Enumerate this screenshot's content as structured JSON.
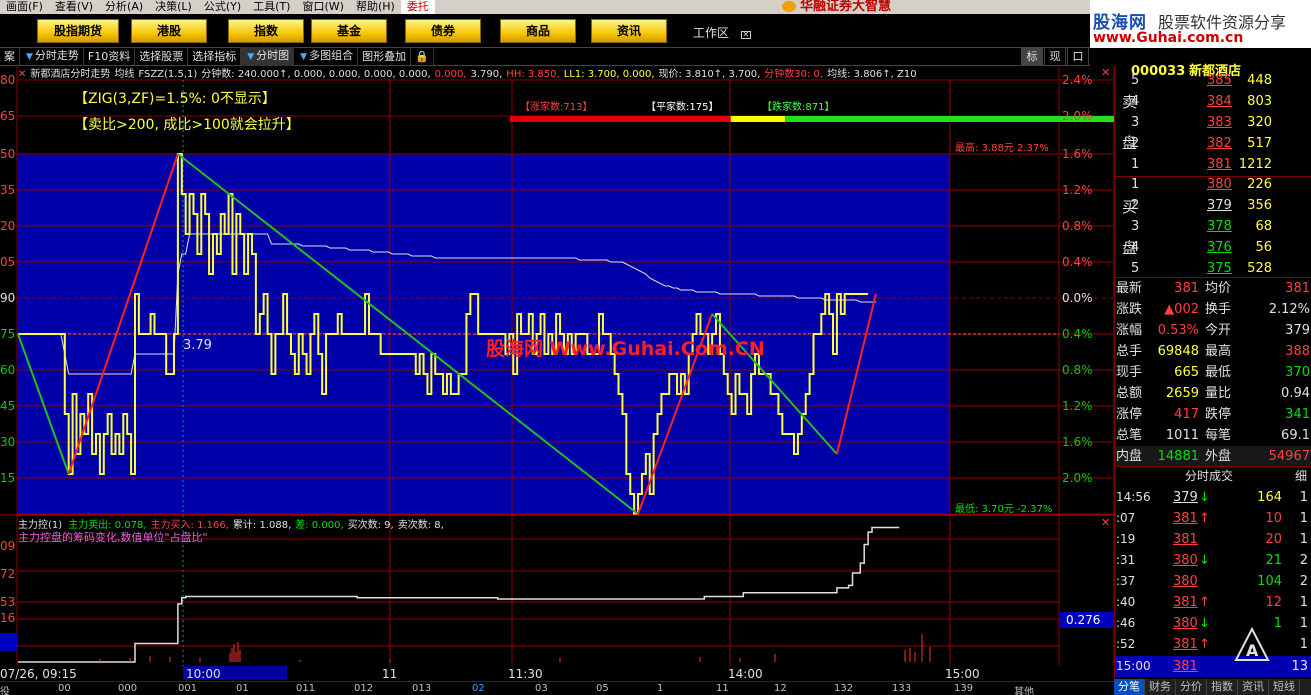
{
  "menubar": {
    "items": [
      "画面(F)",
      "查看(V)",
      "分析(A)",
      "决策(L)",
      "公式(Y)",
      "工具(T)",
      "窗口(W)",
      "帮助(H)",
      "委托"
    ],
    "brand": "华融证券大智慧"
  },
  "logo": {
    "site": "股海网",
    "tagline": "股票软件资源分享",
    "url": "www.Guhai.com.cn"
  },
  "tabs": [
    "股指期货",
    "港股",
    "指数",
    "基金",
    "债券",
    "商品",
    "资讯"
  ],
  "workarea": {
    "label": "工作区",
    "icon": "close-icon"
  },
  "toolbar": {
    "items": [
      "案",
      "分时走势",
      "F10资料",
      "选择股票",
      "选择指标",
      "分时图",
      "多图组合",
      "图形叠加"
    ],
    "right": [
      "标",
      "现",
      "口"
    ]
  },
  "chart": {
    "title": "新都酒店分时走势",
    "info": [
      {
        "t": "均线",
        "c": "wht"
      },
      {
        "t": "FSZZ(1.5,1)",
        "c": "wht"
      },
      {
        "t": "分钟数: 240.000↑, 0.000, 0.000, 0.000, 0.000,",
        "c": "wht"
      },
      {
        "t": "0.000,",
        "c": "red"
      },
      {
        "t": "3.790,",
        "c": "wht"
      },
      {
        "t": "HH: 3.850,",
        "c": "red"
      },
      {
        "t": "LL1: 3.700, 0.000,",
        "c": "yel"
      },
      {
        "t": "现价: 3.810↑, 3.700,",
        "c": "wht"
      },
      {
        "t": "分钟数30: 0,",
        "c": "red"
      },
      {
        "t": "均线: 3.806↑, Z10",
        "c": "wht"
      }
    ],
    "notes": [
      "【ZIG(3,ZF)=1.5%:  0不显示】",
      "【卖比>200,  成比>100就会拉升】"
    ],
    "breadth": {
      "up": "【涨家数:713】",
      "flat": "【平家数:175】",
      "down": "【跌家数:871】",
      "up_count": 713,
      "flat_count": 175,
      "down_count": 871
    },
    "marker_price": "3.79",
    "high_label": "最高: 3.88元  2.37%",
    "low_label": "最低: 3.70元  -2.37%",
    "watermark": "股海网 Www.Guhai.Com.CN",
    "left_axis": [
      "80",
      "65",
      "50",
      "35",
      "20",
      "05",
      "90",
      "75",
      "60",
      "45",
      "30",
      "15"
    ],
    "right_axis": [
      "2.4%",
      "2.0%",
      "1.6%",
      "1.2%",
      "0.8%",
      "0.4%",
      "0.0%",
      "0.4%",
      "0.8%",
      "1.2%",
      "1.6%",
      "2.0%"
    ],
    "price_min": 3.7,
    "price_max": 3.88,
    "prev_close": 3.79,
    "price_series": [
      3.79,
      3.79,
      3.79,
      3.79,
      3.79,
      3.79,
      3.79,
      3.79,
      3.79,
      3.79,
      3.79,
      3.79,
      3.75,
      3.72,
      3.76,
      3.73,
      3.75,
      3.74,
      3.76,
      3.73,
      3.74,
      3.72,
      3.74,
      3.75,
      3.73,
      3.74,
      3.73,
      3.75,
      3.74,
      3.72,
      3.81,
      3.79,
      3.79,
      3.79,
      3.8,
      3.79,
      3.79,
      3.79,
      3.77,
      3.77,
      3.79,
      3.88,
      3.86,
      3.84,
      3.86,
      3.85,
      3.83,
      3.86,
      3.85,
      3.82,
      3.84,
      3.83,
      3.85,
      3.84,
      3.86,
      3.82,
      3.85,
      3.84,
      3.82,
      3.84,
      3.83,
      3.79,
      3.8,
      3.81,
      3.79,
      3.77,
      3.79,
      3.79,
      3.81,
      3.79,
      3.78,
      3.77,
      3.79,
      3.78,
      3.77,
      3.79,
      3.8,
      3.78,
      3.76,
      3.79,
      3.79,
      3.79,
      3.8,
      3.79,
      3.79,
      3.79,
      3.79,
      3.79,
      3.79,
      3.81,
      3.79,
      3.79,
      3.79,
      3.78,
      3.78,
      3.78,
      3.78,
      3.78,
      3.78,
      3.78,
      3.78,
      3.78,
      3.77,
      3.78,
      3.77,
      3.76,
      3.78,
      3.77,
      3.77,
      3.76,
      3.77,
      3.76,
      3.76,
      3.77,
      3.77,
      3.8,
      3.81,
      3.81,
      3.79,
      3.79,
      3.79,
      3.79,
      3.79,
      3.79,
      3.79,
      3.78,
      3.79,
      3.77,
      3.8,
      3.79,
      3.79,
      3.8,
      3.78,
      3.79,
      3.8,
      3.78,
      3.79,
      3.78,
      3.8,
      3.79,
      3.78,
      3.79,
      3.78,
      3.79,
      3.79,
      3.79,
      3.78,
      3.78,
      3.78,
      3.8,
      3.79,
      3.79,
      3.78,
      3.77,
      3.76,
      3.75,
      3.72,
      3.71,
      3.7,
      3.71,
      3.72,
      3.73,
      3.71,
      3.74,
      3.75,
      3.76,
      3.76,
      3.77,
      3.77,
      3.76,
      3.77,
      3.76,
      3.78,
      3.79,
      3.8,
      3.79,
      3.79,
      3.78,
      3.79,
      3.8,
      3.78,
      3.77,
      3.76,
      3.75,
      3.77,
      3.76,
      3.76,
      3.75,
      3.77,
      3.78,
      3.77,
      3.77,
      3.77,
      3.76,
      3.76,
      3.75,
      3.74,
      3.74,
      3.74,
      3.73,
      3.74,
      3.75,
      3.76,
      3.77,
      3.79,
      3.79,
      3.8,
      3.81,
      3.8,
      3.78,
      3.81,
      3.8,
      3.81,
      3.81,
      3.81,
      3.81,
      3.81,
      3.81,
      3.81
    ],
    "avg_series": [
      3.79,
      3.79,
      3.79,
      3.79,
      3.79,
      3.79,
      3.79,
      3.79,
      3.79,
      3.79,
      3.79,
      3.79,
      3.78,
      3.77,
      3.77,
      3.77,
      3.77,
      3.77,
      3.77,
      3.77,
      3.77,
      3.77,
      3.77,
      3.77,
      3.77,
      3.77,
      3.77,
      3.77,
      3.77,
      3.77,
      3.78,
      3.78,
      3.78,
      3.78,
      3.78,
      3.78,
      3.78,
      3.78,
      3.78,
      3.78,
      3.78,
      3.82,
      3.83,
      3.83,
      3.84,
      3.84,
      3.84,
      3.84,
      3.84,
      3.84,
      3.84,
      3.84,
      3.84,
      3.84,
      3.84,
      3.84,
      3.84,
      3.84,
      3.84,
      3.84,
      3.84,
      3.84,
      3.84,
      3.84,
      3.84,
      3.835,
      3.835,
      3.835,
      3.835,
      3.835,
      3.835,
      3.835,
      3.835,
      3.834,
      3.834,
      3.834,
      3.834,
      3.834,
      3.834,
      3.834,
      3.833,
      3.833,
      3.833,
      3.833,
      3.833,
      3.832,
      3.832,
      3.832,
      3.832,
      3.832,
      3.832,
      3.831,
      3.831,
      3.831,
      3.831,
      3.831,
      3.83,
      3.83,
      3.83,
      3.83,
      3.83,
      3.829,
      3.829,
      3.829,
      3.829,
      3.829,
      3.829,
      3.828,
      3.828,
      3.828,
      3.828,
      3.828,
      3.828,
      3.828,
      3.828,
      3.828,
      3.828,
      3.828,
      3.828,
      3.828,
      3.828,
      3.828,
      3.828,
      3.828,
      3.828,
      3.828,
      3.828,
      3.828,
      3.828,
      3.828,
      3.828,
      3.828,
      3.828,
      3.828,
      3.828,
      3.828,
      3.828,
      3.828,
      3.828,
      3.828,
      3.828,
      3.828,
      3.828,
      3.828,
      3.827,
      3.827,
      3.827,
      3.827,
      3.827,
      3.827,
      3.827,
      3.827,
      3.826,
      3.826,
      3.826,
      3.826,
      3.825,
      3.824,
      3.823,
      3.822,
      3.821,
      3.82,
      3.818,
      3.817,
      3.816,
      3.815,
      3.814,
      3.814,
      3.813,
      3.813,
      3.812,
      3.812,
      3.812,
      3.812,
      3.811,
      3.811,
      3.811,
      3.811,
      3.811,
      3.811,
      3.81,
      3.81,
      3.81,
      3.81,
      3.81,
      3.81,
      3.81,
      3.81,
      3.81,
      3.81,
      3.809,
      3.809,
      3.809,
      3.809,
      3.809,
      3.809,
      3.809,
      3.809,
      3.809,
      3.809,
      3.808,
      3.808,
      3.808,
      3.808,
      3.808,
      3.808,
      3.808,
      3.807,
      3.807,
      3.807,
      3.807,
      3.807,
      3.807,
      3.807,
      3.807,
      3.807,
      3.806,
      3.806,
      3.806,
      3.806,
      3.806
    ],
    "zig_points": [
      {
        "i": 0,
        "p": 3.79
      },
      {
        "i": 13,
        "p": 3.72
      },
      {
        "i": 41,
        "p": 3.88
      },
      {
        "i": 159,
        "p": 3.7
      },
      {
        "i": 178,
        "p": 3.8
      },
      {
        "i": 210,
        "p": 3.73
      },
      {
        "i": 220,
        "p": 3.81
      }
    ],
    "time_labels": [
      "10:00",
      "11",
      "11:30",
      "14:00",
      "15:00"
    ]
  },
  "sub_chart": {
    "title": "主力控(1)",
    "info": [
      {
        "t": "主力卖出: 0.078,",
        "c": "grn"
      },
      {
        "t": "主力买入: 1.166,",
        "c": "red"
      },
      {
        "t": "累计: 1.088,",
        "c": "wht"
      },
      {
        "t": "差: 0.000,",
        "c": "grn"
      },
      {
        "t": "买次数: 9,",
        "c": "wht"
      },
      {
        "t": "卖次数: 8,",
        "c": "wht"
      }
    ],
    "desc": "主力控盘的筹码变化,数值单位\"占盘比\"",
    "left_axis": [
      "09",
      "72",
      "53",
      "16"
    ],
    "right_value": "0.276",
    "cum_series": [
      0,
      0,
      0,
      0,
      0,
      0,
      0,
      0,
      0,
      0,
      0,
      0,
      0,
      0,
      0,
      0,
      0,
      0,
      0,
      0,
      0,
      0,
      0,
      0,
      0,
      0,
      0,
      0,
      0,
      0,
      0.15,
      0.15,
      0.15,
      0.15,
      0.15,
      0.15,
      0.15,
      0.15,
      0.15,
      0.15,
      0.15,
      0.47,
      0.52,
      0.53,
      0.53,
      0.53,
      0.53,
      0.53,
      0.53,
      0.53,
      0.53,
      0.53,
      0.53,
      0.53,
      0.53,
      0.53,
      0.53,
      0.53,
      0.53,
      0.53,
      0.53,
      0.53,
      0.53,
      0.53,
      0.53,
      0.53,
      0.53,
      0.53,
      0.53,
      0.53,
      0.53,
      0.53,
      0.53,
      0.53,
      0.53,
      0.53,
      0.53,
      0.53,
      0.53,
      0.53,
      0.53,
      0.53,
      0.53,
      0.53,
      0.53,
      0.53,
      0.53,
      0.52,
      0.52,
      0.52,
      0.52,
      0.52,
      0.52,
      0.52,
      0.52,
      0.52,
      0.52,
      0.52,
      0.52,
      0.52,
      0.52,
      0.52,
      0.52,
      0.52,
      0.52,
      0.52,
      0.52,
      0.52,
      0.52,
      0.52,
      0.52,
      0.52,
      0.52,
      0.52,
      0.52,
      0.52,
      0.52,
      0.52,
      0.52,
      0.52,
      0.52,
      0.52,
      0.52,
      0.51,
      0.51,
      0.51,
      0.51,
      0.51,
      0.51,
      0.51,
      0.51,
      0.51,
      0.51,
      0.51,
      0.51,
      0.51,
      0.51,
      0.51,
      0.51,
      0.51,
      0.51,
      0.51,
      0.51,
      0.51,
      0.51,
      0.51,
      0.51,
      0.51,
      0.51,
      0.51,
      0.51,
      0.51,
      0.51,
      0.51,
      0.51,
      0.51,
      0.51,
      0.51,
      0.51,
      0.51,
      0.51,
      0.51,
      0.51,
      0.51,
      0.51,
      0.51,
      0.51,
      0.51,
      0.51,
      0.51,
      0.51,
      0.51,
      0.51,
      0.51,
      0.51,
      0.51,
      0.53,
      0.53,
      0.53,
      0.53,
      0.53,
      0.53,
      0.53,
      0.53,
      0.53,
      0.53,
      0.56,
      0.56,
      0.56,
      0.56,
      0.56,
      0.56,
      0.56,
      0.56,
      0.56,
      0.56,
      0.56,
      0.56,
      0.56,
      0.56,
      0.56,
      0.56,
      0.56,
      0.56,
      0.56,
      0.56,
      0.56,
      0.56,
      0.56,
      0.56,
      0.6,
      0.6,
      0.6,
      0.62,
      0.72,
      0.72,
      0.8,
      0.95,
      1.05,
      1.088,
      1.088,
      1.088,
      1.088,
      1.088,
      1.088,
      1.088,
      1.088
    ],
    "cum_max": 1.1
  },
  "bottom_bar": {
    "date_label": "07/26, 09:15",
    "codes": [
      "役",
      "00",
      "000",
      "001",
      "01",
      "011",
      "012",
      "013",
      "02",
      "03",
      "05",
      "1",
      "11",
      "12",
      "132",
      "133",
      "139",
      "其他"
    ]
  },
  "quote": {
    "code": "000033",
    "name": "新都酒店",
    "sell_side": "卖盘",
    "buy_side": "买盘",
    "sell": [
      {
        "n": "5",
        "price": "385",
        "vol": "448"
      },
      {
        "n": "4",
        "price": "384",
        "vol": "803"
      },
      {
        "n": "3",
        "price": "383",
        "vol": "320"
      },
      {
        "n": "2",
        "price": "382",
        "vol": "517"
      },
      {
        "n": "1",
        "price": "381",
        "vol": "1212"
      }
    ],
    "buy": [
      {
        "n": "1",
        "price": "380",
        "vol": "226"
      },
      {
        "n": "2",
        "price": "379",
        "vol": "356"
      },
      {
        "n": "3",
        "price": "378",
        "vol": "68"
      },
      {
        "n": "4",
        "price": "376",
        "vol": "56"
      },
      {
        "n": "5",
        "price": "375",
        "vol": "528"
      }
    ],
    "stats": [
      {
        "l1": "最新",
        "v1": "381",
        "c1": "red",
        "l2": "均价",
        "v2": "381",
        "c2": "red"
      },
      {
        "l1": "涨跌",
        "v1": "▲002",
        "c1": "red",
        "l2": "换手",
        "v2": "2.12%",
        "c2": "wht"
      },
      {
        "l1": "涨幅",
        "v1": "0.53%",
        "c1": "red",
        "l2": "今开",
        "v2": "379",
        "c2": "wht"
      },
      {
        "l1": "总手",
        "v1": "69848",
        "c1": "yel",
        "l2": "最高",
        "v2": "388",
        "c2": "red"
      },
      {
        "l1": "现手",
        "v1": "665",
        "c1": "yel",
        "l2": "最低",
        "v2": "370",
        "c2": "grn"
      },
      {
        "l1": "总额",
        "v1": "2659",
        "c1": "yel",
        "l2": "量比",
        "v2": "0.94",
        "c2": "wht"
      },
      {
        "l1": "涨停",
        "v1": "417",
        "c1": "red",
        "l2": "跌停",
        "v2": "341",
        "c2": "grn"
      },
      {
        "l1": "总笔",
        "v1": "1011",
        "c1": "wht",
        "l2": "每笔",
        "v2": "69.1",
        "c2": "wht"
      },
      {
        "l1": "内盘",
        "v1": "14881",
        "c1": "grn",
        "l2": "外盘",
        "v2": "54967",
        "c2": "red"
      }
    ],
    "trades_title": "分时成交",
    "trades_right": "细",
    "trades": [
      {
        "t": "14:56",
        "p": "379",
        "pc": "wht",
        "d": "↓",
        "dc": "grn",
        "v": "164",
        "vc": "yel",
        "n": "1"
      },
      {
        "t": ":07",
        "p": "381",
        "pc": "red",
        "d": "↑",
        "dc": "red",
        "v": "10",
        "vc": "red",
        "n": "1"
      },
      {
        "t": ":19",
        "p": "381",
        "pc": "red",
        "d": "",
        "dc": "red",
        "v": "20",
        "vc": "red",
        "n": "1"
      },
      {
        "t": ":31",
        "p": "380",
        "pc": "red",
        "d": "↓",
        "dc": "grn",
        "v": "21",
        "vc": "grn",
        "n": "2"
      },
      {
        "t": ":37",
        "p": "380",
        "pc": "red",
        "d": "",
        "dc": "grn",
        "v": "104",
        "vc": "grn",
        "n": "2"
      },
      {
        "t": ":40",
        "p": "381",
        "pc": "red",
        "d": "↑",
        "dc": "red",
        "v": "12",
        "vc": "red",
        "n": "1"
      },
      {
        "t": ":46",
        "p": "380",
        "pc": "red",
        "d": "↓",
        "dc": "grn",
        "v": "1",
        "vc": "grn",
        "n": "1"
      },
      {
        "t": ":52",
        "p": "381",
        "pc": "red",
        "d": "↑",
        "dc": "red",
        "v": "",
        "vc": "red",
        "n": "1"
      }
    ],
    "last_trade": {
      "t": "15:00",
      "p": "381",
      "tail": "13"
    },
    "bottom_tabs": [
      "分笔",
      "财务",
      "分价",
      "指数",
      "资讯",
      "短线"
    ]
  },
  "colors": {
    "chart_bg": "#0000a8",
    "price": "#ffff40",
    "avg": "#e0e0e0",
    "zig_up": "#ff2020",
    "zig_down": "#20c020",
    "grid": "#8b0000",
    "up": "#ff4040",
    "down": "#00e000"
  }
}
